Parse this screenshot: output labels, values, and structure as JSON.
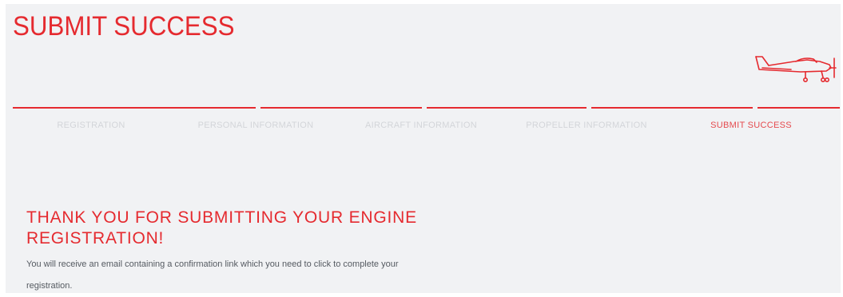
{
  "page": {
    "title": "SUBMIT SUCCESS"
  },
  "progress": {
    "current_step": 5,
    "total_steps": 5,
    "steps": [
      {
        "label": "REGISTRATION",
        "state": "completed"
      },
      {
        "label": "PERSONAL INFORMATION",
        "state": "completed"
      },
      {
        "label": "AIRCRAFT INFORMATION",
        "state": "completed"
      },
      {
        "label": "PROPELLER INFORMATION",
        "state": "completed"
      },
      {
        "label": "SUBMIT SUCCESS",
        "state": "current"
      }
    ]
  },
  "confirmation": {
    "heading": "THANK YOU FOR SUBMITTING YOUR ENGINE REGISTRATION!",
    "message": "You will receive an email containing a confirmation link which you need to click to complete your registration."
  },
  "icons": {
    "header_illustration": "airplane-icon"
  },
  "colors": {
    "accent": "#e52a2f",
    "background": "#f1f2f4",
    "inactive_step_text": "#d3d5d9",
    "body_text": "#555a61"
  }
}
